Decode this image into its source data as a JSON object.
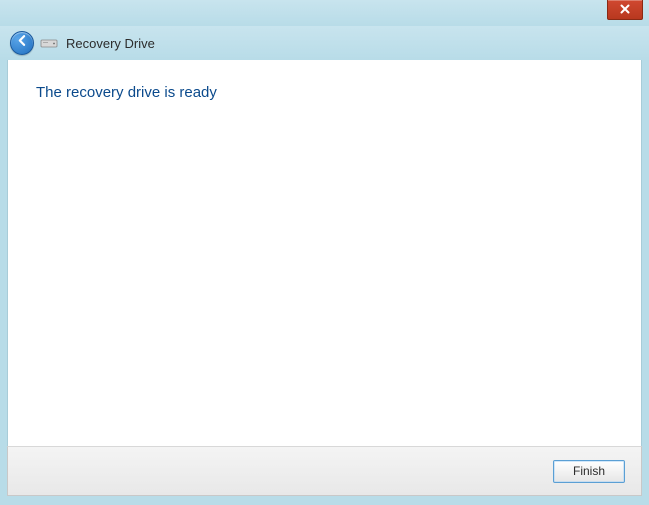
{
  "window": {
    "title": "Recovery Drive"
  },
  "content": {
    "heading": "The recovery drive is ready"
  },
  "footer": {
    "finish_label": "Finish"
  }
}
